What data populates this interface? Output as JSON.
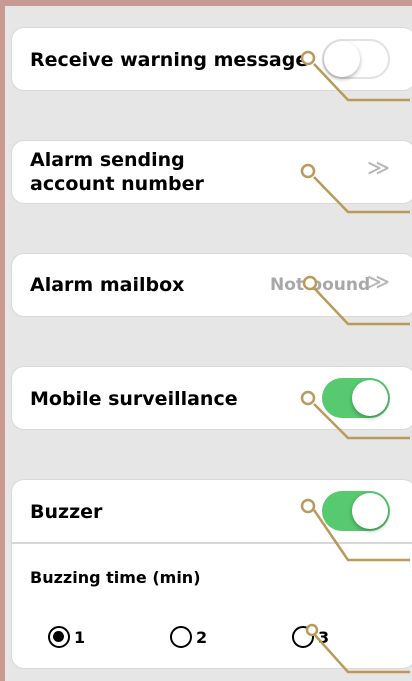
{
  "settings": {
    "receive_warning": {
      "label": "Receive warning message",
      "enabled": false
    },
    "alarm_account": {
      "label_line1": "Alarm sending",
      "label_line2": "account number",
      "chevron": "≫"
    },
    "alarm_mailbox": {
      "label": "Alarm mailbox",
      "value": "Not bound",
      "chevron": "≫"
    },
    "mobile_surveillance": {
      "label": "Mobile surveillance",
      "enabled": true
    },
    "buzzer": {
      "label": "Buzzer",
      "enabled": true,
      "buzzing_time_label": "Buzzing time (min)",
      "options": [
        {
          "label": "1",
          "selected": true
        },
        {
          "label": "2",
          "selected": false
        },
        {
          "label": "3",
          "selected": false
        }
      ]
    }
  },
  "colors": {
    "toggle_on": "#57c96f",
    "annotation": "#b99a5a",
    "frame": "#c89a94"
  }
}
